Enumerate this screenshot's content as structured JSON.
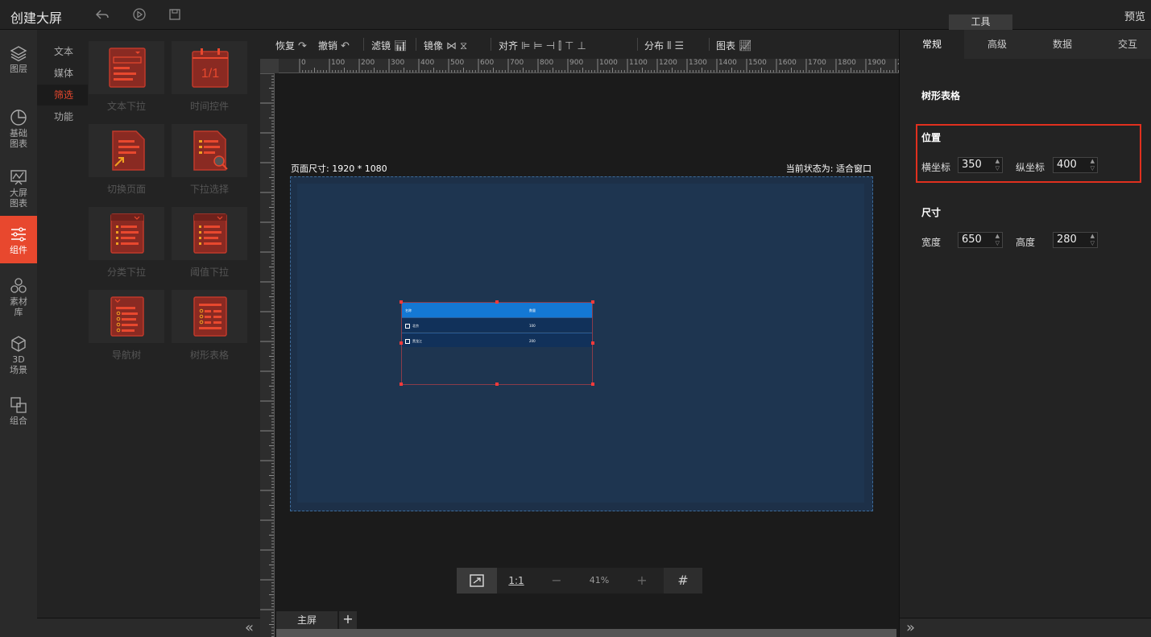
{
  "topbar": {
    "title": "创建大屏",
    "icons": [
      "undo-arrow-icon",
      "play-icon",
      "save-icon"
    ],
    "tools_tab": "工具",
    "preview": "预览"
  },
  "left_nav": {
    "items": [
      {
        "label": "图层",
        "icon": "layers-icon"
      },
      {
        "label": "基础图表",
        "icon": "pie-chart-icon"
      },
      {
        "label": "大屏图表",
        "icon": "line-chart-icon"
      },
      {
        "label": "组件",
        "icon": "sliders-icon",
        "active": true
      },
      {
        "label": "素材库",
        "icon": "hexagons-icon"
      },
      {
        "label": "3D场景",
        "icon": "cube-icon"
      },
      {
        "label": "组合",
        "icon": "group-icon"
      }
    ]
  },
  "categories": [
    "文本",
    "媒体",
    "筛选",
    "功能"
  ],
  "active_category": "筛选",
  "components": [
    "文本下拉",
    "时间控件",
    "切换页面",
    "下拉选择",
    "分类下拉",
    "阈值下拉",
    "导航树",
    "树形表格"
  ],
  "time_control_glyph": "1/1",
  "toolbar": {
    "redo": "恢复",
    "undo": "撤销",
    "filter": "滤镜",
    "mirror": "镜像",
    "align": "对齐",
    "distribute": "分布",
    "chart": "图表"
  },
  "ruler_ticks": [
    "0",
    "100",
    "200",
    "300",
    "400",
    "500",
    "600",
    "700",
    "800",
    "900",
    "1000",
    "1100",
    "1200",
    "1300",
    "1400",
    "1500",
    "1600",
    "1700",
    "1800",
    "1900",
    "20"
  ],
  "canvas": {
    "page_size": "页面尺寸: 1920 * 1080",
    "current_state": "当前状态为: 适合窗口",
    "widget": {
      "header": [
        "名称",
        "数量"
      ],
      "rows": [
        [
          "北京",
          "100"
        ],
        [
          "黑龙江",
          "200"
        ]
      ]
    }
  },
  "zoom": {
    "ratio_label": "1:1",
    "minus": "−",
    "percent": "41%",
    "plus": "+"
  },
  "screens": {
    "tab": "主屏",
    "add": "+"
  },
  "right_panel": {
    "tabs": [
      "常规",
      "高级",
      "数据",
      "交互"
    ],
    "component_name": "树形表格",
    "position": {
      "title": "位置",
      "x_label": "横坐标",
      "x_value": "350",
      "y_label": "纵坐标",
      "y_value": "400"
    },
    "size": {
      "title": "尺寸",
      "w_label": "宽度",
      "w_value": "650",
      "h_label": "高度",
      "h_value": "280"
    }
  },
  "colors": {
    "accent": "#e8482e",
    "highlight_box": "#e0301e",
    "table_header": "#1478d4"
  }
}
